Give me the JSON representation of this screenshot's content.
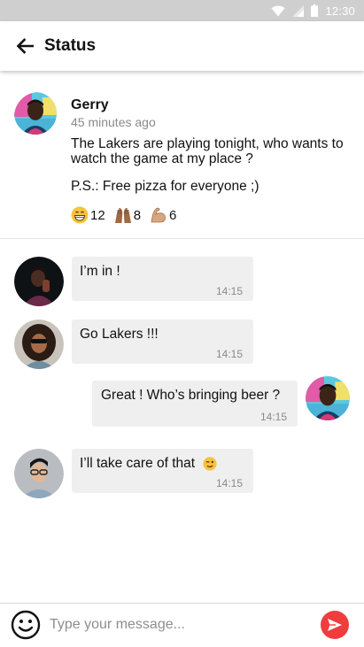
{
  "status_bar": {
    "time": "12:30"
  },
  "header": {
    "title": "Status"
  },
  "post": {
    "author": "Gerry",
    "time_ago": "45 minutes ago",
    "text": "The Lakers are playing tonight, who wants to watch the game at my place ?",
    "ps": "P.S.: Free pizza for everyone ;)",
    "reactions": [
      {
        "icon": "grinning-face-icon",
        "count": "12"
      },
      {
        "icon": "raised-hands-icon",
        "count": "8"
      },
      {
        "icon": "flexed-biceps-icon",
        "count": "6"
      }
    ]
  },
  "messages": [
    {
      "text": "I’m in !",
      "time": "14:15",
      "side": "left"
    },
    {
      "text": "Go Lakers !!!",
      "time": "14:15",
      "side": "left"
    },
    {
      "text": "Great ! Who’s bringing beer ?",
      "time": "14:15",
      "side": "right"
    },
    {
      "text": "I’ll take care of that",
      "time": "14:15",
      "side": "left",
      "emoji": "winking-face-icon"
    }
  ],
  "composer": {
    "placeholder": "Type your message..."
  },
  "colors": {
    "send_button": "#f03c3c",
    "bubble": "#efefef",
    "timestamp": "#8a8a8a"
  }
}
